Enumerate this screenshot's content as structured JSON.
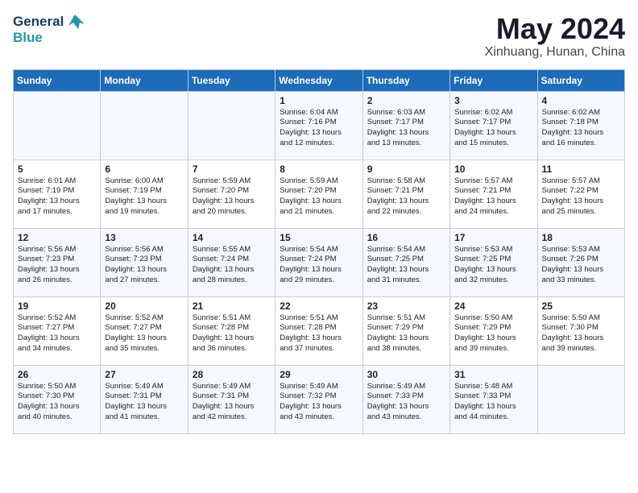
{
  "header": {
    "logo_line1": "General",
    "logo_line2": "Blue",
    "month": "May 2024",
    "location": "Xinhuang, Hunan, China"
  },
  "days_of_week": [
    "Sunday",
    "Monday",
    "Tuesday",
    "Wednesday",
    "Thursday",
    "Friday",
    "Saturday"
  ],
  "weeks": [
    [
      {
        "day": "",
        "info": ""
      },
      {
        "day": "",
        "info": ""
      },
      {
        "day": "",
        "info": ""
      },
      {
        "day": "1",
        "info": "Sunrise: 6:04 AM\nSunset: 7:16 PM\nDaylight: 13 hours\nand 12 minutes."
      },
      {
        "day": "2",
        "info": "Sunrise: 6:03 AM\nSunset: 7:17 PM\nDaylight: 13 hours\nand 13 minutes."
      },
      {
        "day": "3",
        "info": "Sunrise: 6:02 AM\nSunset: 7:17 PM\nDaylight: 13 hours\nand 15 minutes."
      },
      {
        "day": "4",
        "info": "Sunrise: 6:02 AM\nSunset: 7:18 PM\nDaylight: 13 hours\nand 16 minutes."
      }
    ],
    [
      {
        "day": "5",
        "info": "Sunrise: 6:01 AM\nSunset: 7:19 PM\nDaylight: 13 hours\nand 17 minutes."
      },
      {
        "day": "6",
        "info": "Sunrise: 6:00 AM\nSunset: 7:19 PM\nDaylight: 13 hours\nand 19 minutes."
      },
      {
        "day": "7",
        "info": "Sunrise: 5:59 AM\nSunset: 7:20 PM\nDaylight: 13 hours\nand 20 minutes."
      },
      {
        "day": "8",
        "info": "Sunrise: 5:59 AM\nSunset: 7:20 PM\nDaylight: 13 hours\nand 21 minutes."
      },
      {
        "day": "9",
        "info": "Sunrise: 5:58 AM\nSunset: 7:21 PM\nDaylight: 13 hours\nand 22 minutes."
      },
      {
        "day": "10",
        "info": "Sunrise: 5:57 AM\nSunset: 7:21 PM\nDaylight: 13 hours\nand 24 minutes."
      },
      {
        "day": "11",
        "info": "Sunrise: 5:57 AM\nSunset: 7:22 PM\nDaylight: 13 hours\nand 25 minutes."
      }
    ],
    [
      {
        "day": "12",
        "info": "Sunrise: 5:56 AM\nSunset: 7:23 PM\nDaylight: 13 hours\nand 26 minutes."
      },
      {
        "day": "13",
        "info": "Sunrise: 5:56 AM\nSunset: 7:23 PM\nDaylight: 13 hours\nand 27 minutes."
      },
      {
        "day": "14",
        "info": "Sunrise: 5:55 AM\nSunset: 7:24 PM\nDaylight: 13 hours\nand 28 minutes."
      },
      {
        "day": "15",
        "info": "Sunrise: 5:54 AM\nSunset: 7:24 PM\nDaylight: 13 hours\nand 29 minutes."
      },
      {
        "day": "16",
        "info": "Sunrise: 5:54 AM\nSunset: 7:25 PM\nDaylight: 13 hours\nand 31 minutes."
      },
      {
        "day": "17",
        "info": "Sunrise: 5:53 AM\nSunset: 7:25 PM\nDaylight: 13 hours\nand 32 minutes."
      },
      {
        "day": "18",
        "info": "Sunrise: 5:53 AM\nSunset: 7:26 PM\nDaylight: 13 hours\nand 33 minutes."
      }
    ],
    [
      {
        "day": "19",
        "info": "Sunrise: 5:52 AM\nSunset: 7:27 PM\nDaylight: 13 hours\nand 34 minutes."
      },
      {
        "day": "20",
        "info": "Sunrise: 5:52 AM\nSunset: 7:27 PM\nDaylight: 13 hours\nand 35 minutes."
      },
      {
        "day": "21",
        "info": "Sunrise: 5:51 AM\nSunset: 7:28 PM\nDaylight: 13 hours\nand 36 minutes."
      },
      {
        "day": "22",
        "info": "Sunrise: 5:51 AM\nSunset: 7:28 PM\nDaylight: 13 hours\nand 37 minutes."
      },
      {
        "day": "23",
        "info": "Sunrise: 5:51 AM\nSunset: 7:29 PM\nDaylight: 13 hours\nand 38 minutes."
      },
      {
        "day": "24",
        "info": "Sunrise: 5:50 AM\nSunset: 7:29 PM\nDaylight: 13 hours\nand 39 minutes."
      },
      {
        "day": "25",
        "info": "Sunrise: 5:50 AM\nSunset: 7:30 PM\nDaylight: 13 hours\nand 39 minutes."
      }
    ],
    [
      {
        "day": "26",
        "info": "Sunrise: 5:50 AM\nSunset: 7:30 PM\nDaylight: 13 hours\nand 40 minutes."
      },
      {
        "day": "27",
        "info": "Sunrise: 5:49 AM\nSunset: 7:31 PM\nDaylight: 13 hours\nand 41 minutes."
      },
      {
        "day": "28",
        "info": "Sunrise: 5:49 AM\nSunset: 7:31 PM\nDaylight: 13 hours\nand 42 minutes."
      },
      {
        "day": "29",
        "info": "Sunrise: 5:49 AM\nSunset: 7:32 PM\nDaylight: 13 hours\nand 43 minutes."
      },
      {
        "day": "30",
        "info": "Sunrise: 5:49 AM\nSunset: 7:33 PM\nDaylight: 13 hours\nand 43 minutes."
      },
      {
        "day": "31",
        "info": "Sunrise: 5:48 AM\nSunset: 7:33 PM\nDaylight: 13 hours\nand 44 minutes."
      },
      {
        "day": "",
        "info": ""
      }
    ]
  ]
}
